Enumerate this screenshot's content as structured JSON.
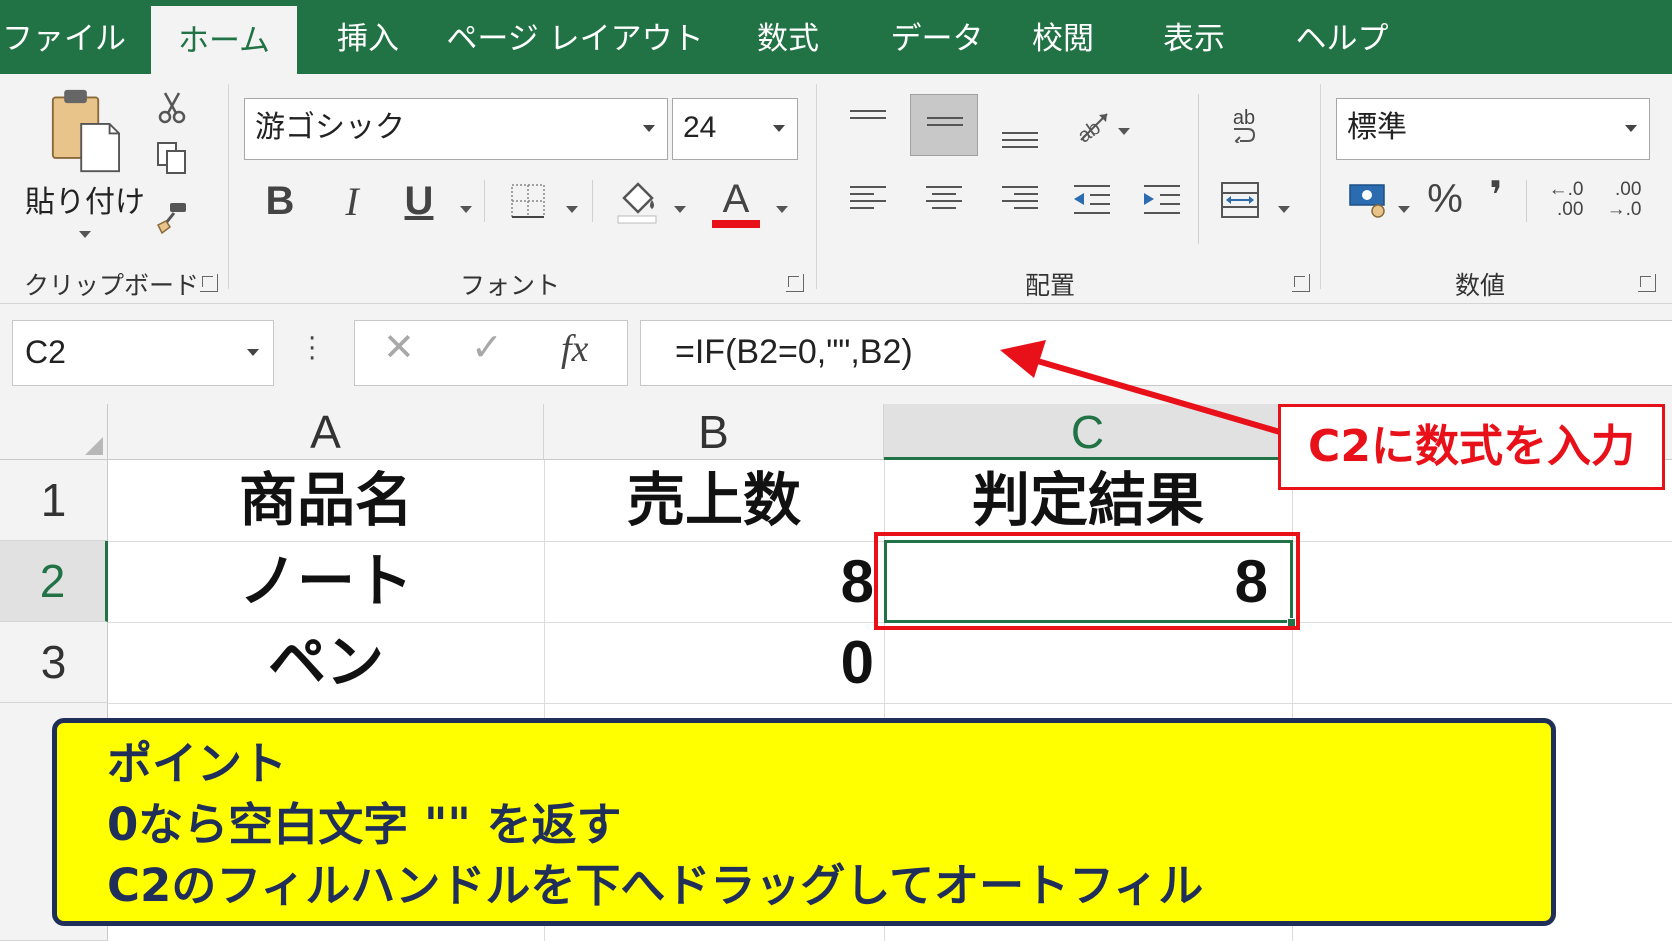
{
  "tabs": [
    "ファイル",
    "ホーム",
    "挿入",
    "ページ レイアウト",
    "数式",
    "データ",
    "校閲",
    "表示",
    "ヘルプ"
  ],
  "active_tab": "ホーム",
  "ribbon": {
    "clipboard": {
      "paste_label": "貼り付け",
      "group_label": "クリップボード"
    },
    "font": {
      "font_name": "游ゴシック",
      "font_size": "24",
      "bold": "B",
      "italic": "I",
      "underline": "U",
      "font_color_glyph": "A",
      "font_color": "#e8111a",
      "group_label": "フォント"
    },
    "alignment": {
      "wrap_glyph": "ab",
      "group_label": "配置"
    },
    "number": {
      "format": "標準",
      "percent": "%",
      "comma": "❜",
      "increase_decimal": "←.0\n.00",
      "decrease_decimal": ".00\n→.0",
      "group_label": "数値"
    }
  },
  "formula_bar": {
    "name_box": "C2",
    "cancel": "✕",
    "enter": "✓",
    "fx": "fx",
    "formula": "=IF(B2=0,\"\",B2)"
  },
  "grid": {
    "columns": [
      "A",
      "B",
      "C"
    ],
    "rows": [
      "1",
      "2",
      "3"
    ],
    "cells": {
      "A1": "商品名",
      "B1": "売上数",
      "C1": "判定結果",
      "A2": "ノート",
      "B2": "8",
      "C2": "8",
      "A3": "ペン",
      "B3": "0",
      "C3": ""
    },
    "active_cell": "C2"
  },
  "annotations": {
    "callout": "C2に数式を入力",
    "note_lines": [
      "ポイント",
      "0なら空白文字 \"\" を返す",
      "C2のフィルハンドルを下へドラッグしてオートフィル"
    ]
  },
  "colors": {
    "excel_green": "#217346",
    "annotation_red": "#e8111a",
    "note_yellow": "#ffff00",
    "note_navy": "#1f2f5a"
  }
}
